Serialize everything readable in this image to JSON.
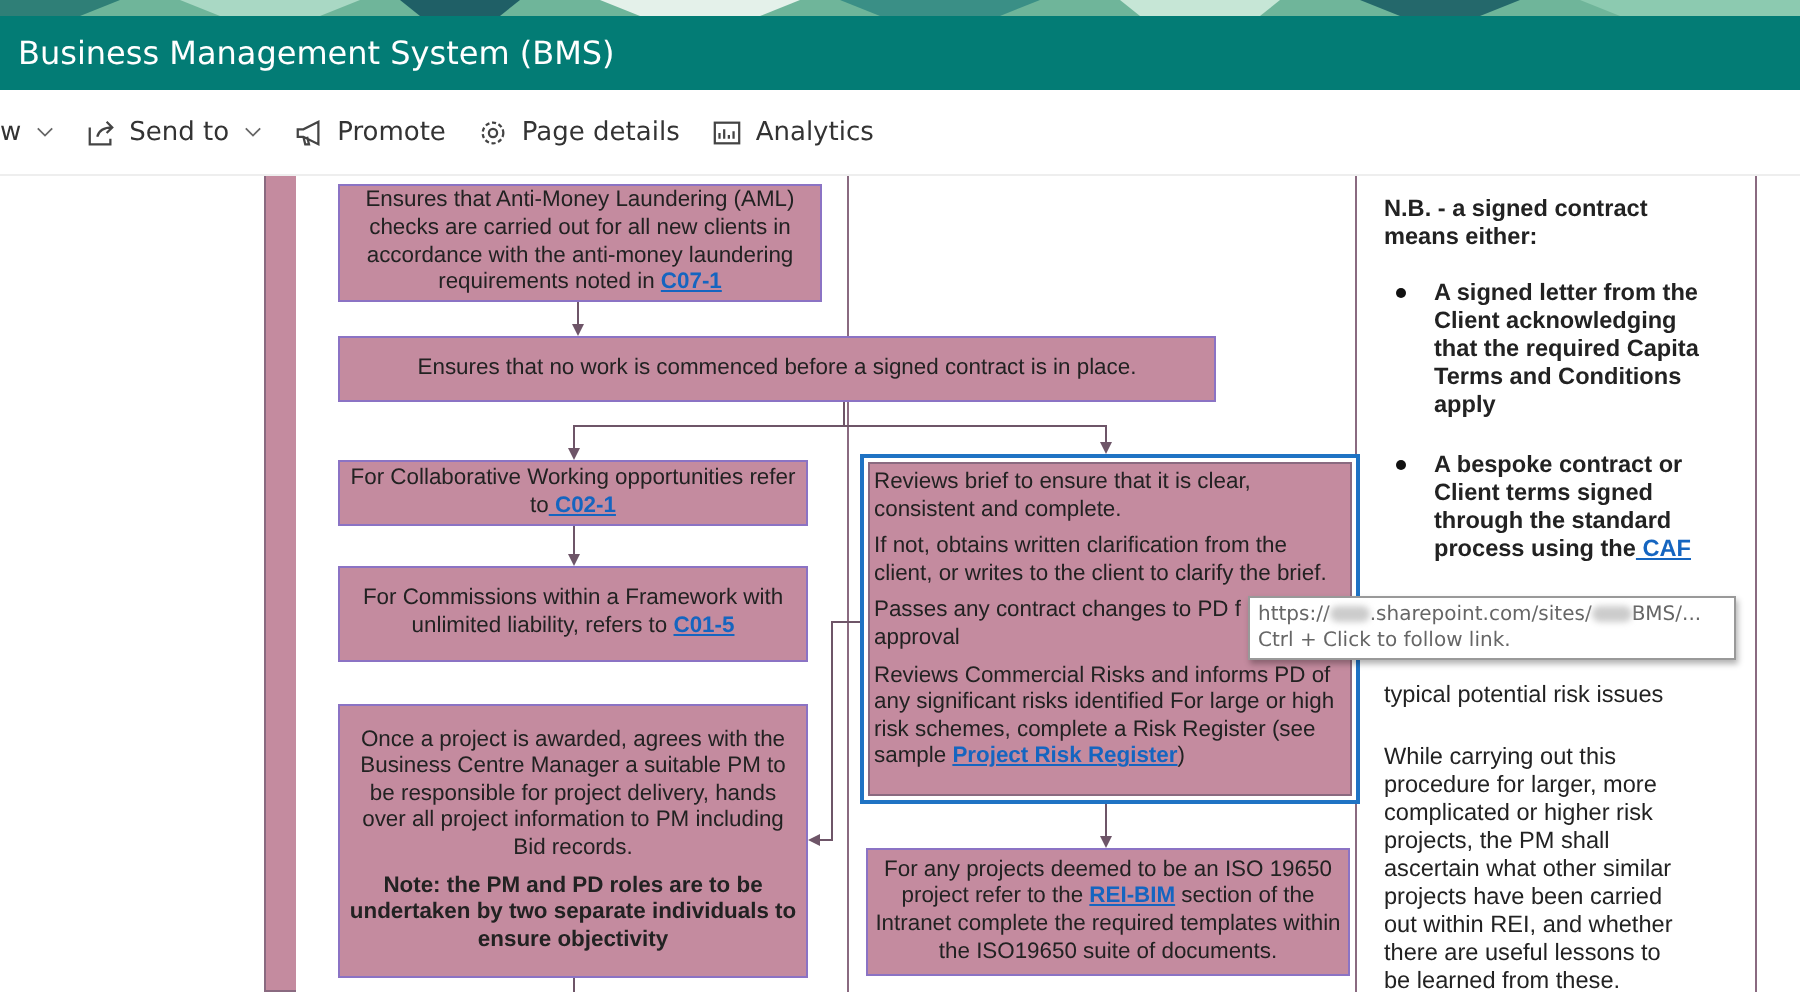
{
  "header": {
    "title": "Business Management System (BMS)"
  },
  "toolbar": [
    {
      "label": "w",
      "kind": "dropdown"
    },
    {
      "label": "Send to",
      "kind": "dropdown"
    },
    {
      "label": "Promote",
      "kind": "button"
    },
    {
      "label": "Page details",
      "kind": "button"
    },
    {
      "label": "Analytics",
      "kind": "button"
    }
  ],
  "diagram": {
    "nodes": [
      {
        "selected": false,
        "paragraphs": [
          {
            "bold": false,
            "segments": [
              {
                "kind": "text",
                "text": "Ensures that  Anti-Money Laundering (AML) checks are carried out for all new clients in accordance with the anti-money laundering requirements noted in "
              },
              {
                "kind": "link",
                "text": "C07-1"
              }
            ]
          }
        ]
      },
      {
        "selected": false,
        "paragraphs": [
          {
            "bold": false,
            "segments": [
              {
                "kind": "text",
                "text": "Ensures that no work is commenced before a signed contract is in place."
              }
            ]
          }
        ]
      },
      {
        "selected": false,
        "paragraphs": [
          {
            "bold": false,
            "segments": [
              {
                "kind": "text",
                "text": "For Collaborative Working opportunities refer to"
              },
              {
                "kind": "link",
                "text": " C02-1 "
              }
            ]
          }
        ]
      },
      {
        "selected": false,
        "paragraphs": [
          {
            "bold": false,
            "segments": [
              {
                "kind": "text",
                "text": "For Commissions within a Framework with unlimited liability, refers to "
              },
              {
                "kind": "link",
                "text": "C01-5"
              }
            ]
          }
        ]
      },
      {
        "selected": false,
        "paragraphs": [
          {
            "bold": false,
            "segments": [
              {
                "kind": "text",
                "text": "Once a project is awarded, agrees with the Business Centre Manager a suitable PM to be responsible for project delivery, hands over all project information to PM including Bid records."
              }
            ]
          },
          {
            "bold": true,
            "segments": [
              {
                "kind": "text",
                "text": "Note: the PM and PD roles are to be undertaken by two separate individuals to ensure objectivity"
              }
            ]
          }
        ]
      },
      {
        "selected": true,
        "kind": "checklist",
        "paragraphs": [
          {
            "bold": false,
            "segments": [
              {
                "kind": "text",
                "text": "Reviews brief to ensure that it is clear, consistent and complete."
              }
            ]
          },
          {
            "bold": false,
            "segments": [
              {
                "kind": "text",
                "text": "If not, obtains written clarification from the client, or writes to the client to clarify the brief."
              }
            ]
          },
          {
            "bold": false,
            "segments": [
              {
                "kind": "text",
                "text": "Passes any contract changes to PD f"
              },
              {
                "kind": "break"
              },
              {
                "kind": "text",
                "text": "approval"
              }
            ]
          },
          {
            "bold": false,
            "segments": [
              {
                "kind": "text",
                "text": "Reviews Commercial Risks  and informs PD of any significant risks identified  For large or high risk schemes, complete a Risk Register (see sample "
              },
              {
                "kind": "link",
                "text": "Project Risk Register"
              },
              {
                "kind": "text",
                "text": ")"
              }
            ]
          }
        ]
      },
      {
        "selected": false,
        "paragraphs": [
          {
            "bold": false,
            "segments": [
              {
                "kind": "text",
                "text": "For any projects deemed to be an ISO 19650 project refer to the "
              },
              {
                "kind": "link",
                "text": "REI-BIM"
              },
              {
                "kind": "text",
                "text": " section of the Intranet complete the required templates within the ISO19650 suite of documents."
              }
            ]
          }
        ]
      }
    ],
    "notes": [
      {
        "kind": "text",
        "bold": true,
        "segments": [
          {
            "kind": "text",
            "text": "N.B. -  a signed contract means either:"
          }
        ]
      },
      {
        "kind": "bullet",
        "bold": true,
        "segments": [
          {
            "kind": "text",
            "text": "A signed letter from the Client acknowledging that the required Capita Terms and Conditions apply"
          }
        ]
      },
      {
        "kind": "bullet",
        "bold": true,
        "segments": [
          {
            "kind": "text",
            "text": "A bespoke contract or Client terms signed through the standard process using the"
          },
          {
            "kind": "link",
            "text": " CAF"
          }
        ]
      },
      {
        "kind": "text",
        "bold": false,
        "segments": [
          {
            "kind": "text",
            "text": "typical potential risk issues"
          }
        ]
      },
      {
        "kind": "text",
        "bold": false,
        "segments": [
          {
            "kind": "text",
            "text": "While carrying out this procedure for larger, more complicated or higher risk projects, the PM shall ascertain what other similar projects have been carried out within REI, and whether there are useful lessons to be learned from these."
          }
        ]
      }
    ]
  },
  "tooltip": {
    "url": [
      {
        "kind": "text",
        "text": "https://"
      },
      {
        "kind": "blur"
      },
      {
        "kind": "text",
        "text": ".sharepoint.com/sites/"
      },
      {
        "kind": "blur"
      },
      {
        "kind": "text",
        "text": "BMS/..."
      }
    ],
    "hint": "Ctrl + Click to follow link."
  }
}
